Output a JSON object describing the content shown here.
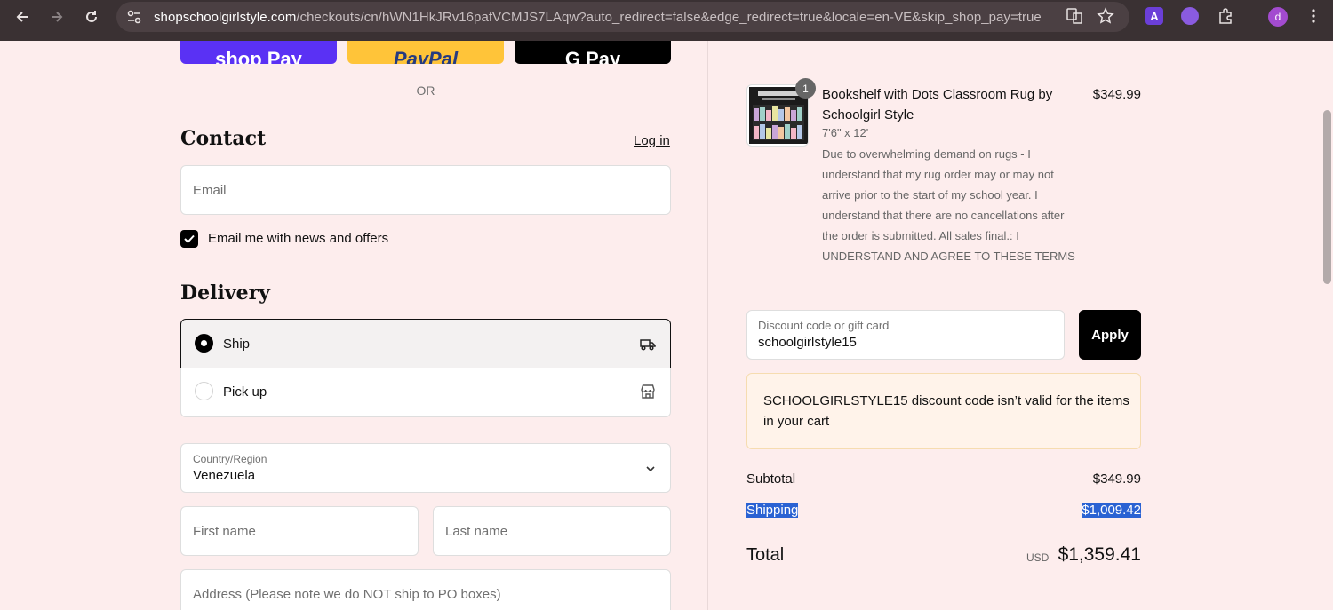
{
  "browser": {
    "url_host": "shopschoolgirlstyle.com",
    "url_path": "/checkouts/cn/hWN1HkJRv16pafVCMJS7LAqw?auto_redirect=false&edge_redirect=true&locale=en-VE&skip_shop_pay=true",
    "profile_initial": "d",
    "ext_letter": "A"
  },
  "express": {
    "shop_pay_label": "shop Pay",
    "paypal_label": "PayPal",
    "gpay_label": "G Pay",
    "or_label": "OR"
  },
  "contact": {
    "heading": "Contact",
    "login_label": "Log in",
    "email_placeholder": "Email",
    "newsletter_label": "Email me with news and offers",
    "newsletter_checked": true
  },
  "delivery": {
    "heading": "Delivery",
    "options": [
      {
        "label": "Ship",
        "selected": true,
        "icon": "truck-icon"
      },
      {
        "label": "Pick up",
        "selected": false,
        "icon": "store-icon"
      }
    ],
    "country_label": "Country/Region",
    "country_value": "Venezuela",
    "first_name_placeholder": "First name",
    "last_name_placeholder": "Last name",
    "address_placeholder": "Address (Please note we do NOT ship to PO boxes)"
  },
  "order": {
    "item": {
      "quantity": "1",
      "title": "Bookshelf with Dots Classroom Rug by Schoolgirl Style",
      "variant": "7'6\" x 12'",
      "note": "Due to overwhelming demand on rugs - I understand that my rug order may or may not arrive prior to the start of my school year. I understand that there are no cancellations after the order is submitted. All sales final.: I UNDERSTAND AND AGREE TO THESE TERMS",
      "price": "$349.99"
    },
    "discount": {
      "label": "Discount code or gift card",
      "value": "schoolgirlstyle15",
      "apply_label": "Apply",
      "error": "SCHOOLGIRLSTYLE15 discount code isn’t valid for the items in your cart"
    },
    "summary": {
      "subtotal_label": "Subtotal",
      "subtotal_value": "$349.99",
      "shipping_label": "Shipping",
      "shipping_value": "$1,009.42",
      "total_label": "Total",
      "currency": "USD",
      "total_value": "$1,359.41"
    }
  },
  "colors": {
    "page_bg": "#fdeded",
    "shop_pay": "#5a31f4",
    "paypal": "#ffc439",
    "selection": "#2a62d3"
  }
}
